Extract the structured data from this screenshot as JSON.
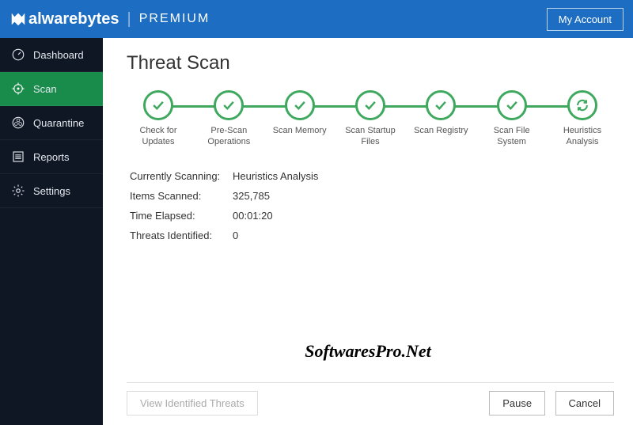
{
  "header": {
    "brand_main": "alwarebytes",
    "brand_suffix": "PREMIUM",
    "my_account": "My Account"
  },
  "sidebar": {
    "items": [
      {
        "label": "Dashboard"
      },
      {
        "label": "Scan"
      },
      {
        "label": "Quarantine"
      },
      {
        "label": "Reports"
      },
      {
        "label": "Settings"
      }
    ]
  },
  "main": {
    "title": "Threat Scan",
    "steps": [
      "Check for Updates",
      "Pre-Scan Operations",
      "Scan Memory",
      "Scan Startup Files",
      "Scan Registry",
      "Scan File System",
      "Heuristics Analysis"
    ],
    "stats": {
      "currently_scanning_label": "Currently Scanning:",
      "currently_scanning_value": "Heuristics Analysis",
      "items_scanned_label": "Items Scanned:",
      "items_scanned_value": "325,785",
      "time_elapsed_label": "Time Elapsed:",
      "time_elapsed_value": "00:01:20",
      "threats_identified_label": "Threats Identified:",
      "threats_identified_value": "0"
    },
    "watermark": "SoftwaresPro.Net",
    "footer": {
      "view_threats": "View Identified Threats",
      "pause": "Pause",
      "cancel": "Cancel"
    }
  }
}
